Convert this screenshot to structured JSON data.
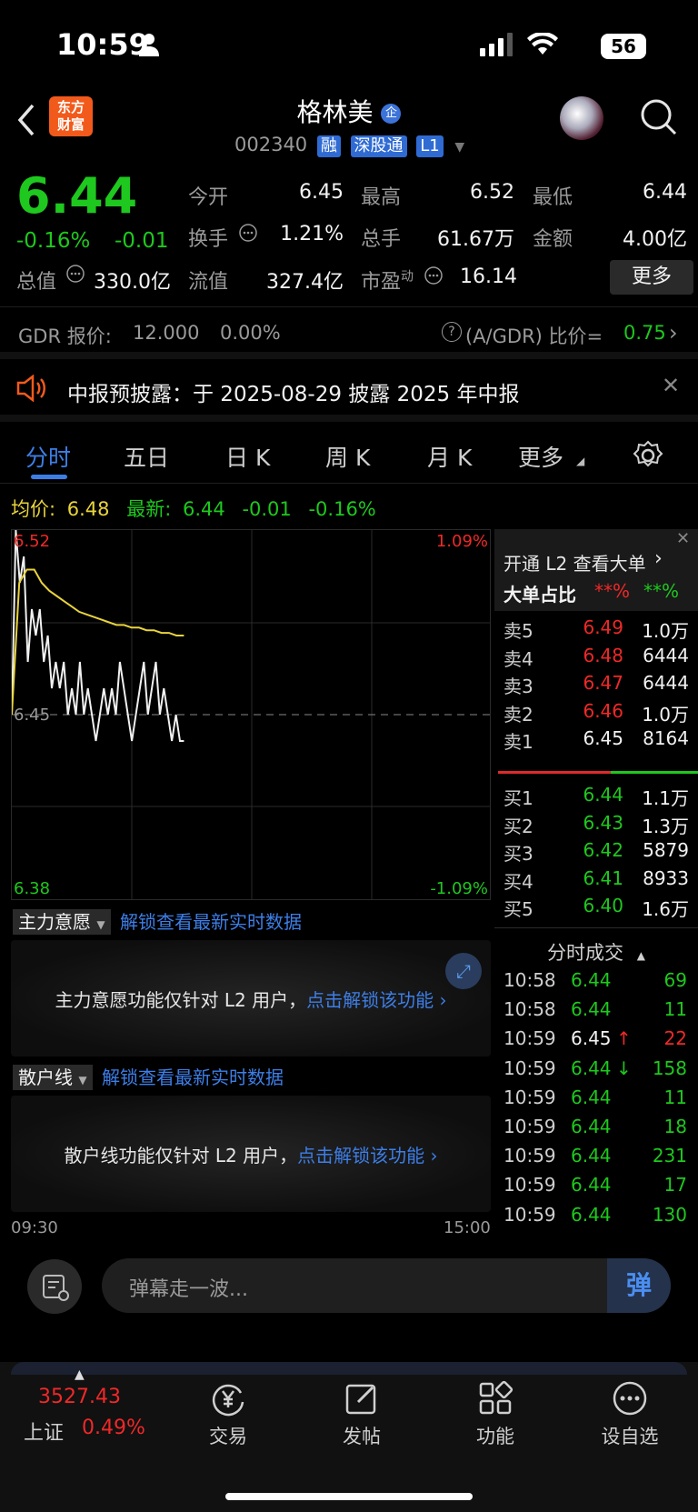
{
  "status": {
    "time": "10:59",
    "battery": "56"
  },
  "header": {
    "brand": "东方财富",
    "title": "格林美",
    "title_badge": "企",
    "code": "002340",
    "tags": [
      "融",
      "深股通",
      "L1"
    ]
  },
  "quote": {
    "price": "6.44",
    "pct": "-0.16%",
    "chg": "-0.01",
    "stats": [
      {
        "label": "今开",
        "value": "6.45"
      },
      {
        "label": "最高",
        "value": "6.52"
      },
      {
        "label": "最低",
        "value": "6.44"
      },
      {
        "label": "换手",
        "value": "1.21%"
      },
      {
        "label": "总手",
        "value": "61.67万"
      },
      {
        "label": "金额",
        "value": "4.00亿"
      },
      {
        "label": "总值",
        "value": "330.0亿"
      },
      {
        "label": "流值",
        "value": "327.4亿"
      },
      {
        "label": "市盈",
        "sup": "动",
        "value": "16.14"
      }
    ],
    "more": "更多"
  },
  "gdr": {
    "label": "GDR 报价:",
    "price": "12.000",
    "pct": "0.00%",
    "ratio_label": "(A/GDR) 比价=",
    "ratio": "0.75"
  },
  "notice": {
    "text": "中报预披露：于 2025-08-29 披露 2025 年中报"
  },
  "tabs": [
    "分时",
    "五日",
    "日 K",
    "周 K",
    "月 K",
    "更多"
  ],
  "infobar": {
    "avg_label": "均价:",
    "avg": "6.48",
    "last_label": "最新:",
    "last": "6.44",
    "chg": "-0.01",
    "pct": "-0.16%"
  },
  "chart": {
    "y_top": "6.52",
    "y_mid": "6.45",
    "y_bottom": "6.38",
    "pct_top": "1.09%",
    "pct_bottom": "-1.09%",
    "t_start": "09:30",
    "t_end": "15:00"
  },
  "chart_data": {
    "type": "line",
    "ylim": [
      6.38,
      6.52
    ],
    "series": [
      {
        "values": [
          6.45,
          6.52,
          6.5,
          6.51,
          6.47,
          6.49,
          6.48,
          6.49,
          6.47,
          6.48,
          6.46,
          6.47,
          6.46,
          6.47,
          6.45,
          6.46,
          6.45,
          6.47,
          6.45,
          6.46,
          6.45,
          6.44,
          6.45,
          6.46,
          6.45,
          6.46,
          6.45,
          6.47,
          6.46,
          6.45,
          6.44,
          6.45,
          6.46,
          6.47,
          6.45,
          6.46,
          6.47,
          6.45,
          6.46,
          6.45,
          6.44,
          6.45,
          6.44,
          6.44
        ]
      },
      {
        "values": [
          6.45,
          6.5,
          6.505,
          6.505,
          6.5,
          6.497,
          6.495,
          6.493,
          6.491,
          6.489,
          6.488,
          6.487,
          6.486,
          6.485,
          6.484,
          6.484,
          6.483,
          6.483,
          6.482,
          6.482,
          6.481,
          6.481,
          6.48,
          6.48
        ]
      }
    ]
  },
  "l2": {
    "link": "开通 L2 查看大单",
    "ratio_label": "大单占比",
    "red": "**%",
    "green": "**%"
  },
  "asks": [
    {
      "label": "卖5",
      "price": "6.49",
      "vol": "1.0万"
    },
    {
      "label": "卖4",
      "price": "6.48",
      "vol": "6444"
    },
    {
      "label": "卖3",
      "price": "6.47",
      "vol": "6444"
    },
    {
      "label": "卖2",
      "price": "6.46",
      "vol": "1.0万"
    },
    {
      "label": "卖1",
      "price": "6.45",
      "vol": "8164"
    }
  ],
  "bids": [
    {
      "label": "买1",
      "price": "6.44",
      "vol": "1.1万"
    },
    {
      "label": "买2",
      "price": "6.43",
      "vol": "1.3万"
    },
    {
      "label": "买3",
      "price": "6.42",
      "vol": "5879"
    },
    {
      "label": "买4",
      "price": "6.41",
      "vol": "8933"
    },
    {
      "label": "买5",
      "price": "6.40",
      "vol": "1.6万"
    }
  ],
  "trades_title": "分时成交",
  "trades": [
    {
      "t": "10:58",
      "p": "6.44",
      "a": "",
      "v": "69",
      "c": "green"
    },
    {
      "t": "10:58",
      "p": "6.44",
      "a": "",
      "v": "11",
      "c": "green"
    },
    {
      "t": "10:59",
      "p": "6.45",
      "a": "↑",
      "v": "22",
      "c": "red"
    },
    {
      "t": "10:59",
      "p": "6.44",
      "a": "↓",
      "v": "158",
      "c": "green"
    },
    {
      "t": "10:59",
      "p": "6.44",
      "a": "",
      "v": "11",
      "c": "green"
    },
    {
      "t": "10:59",
      "p": "6.44",
      "a": "",
      "v": "18",
      "c": "green"
    },
    {
      "t": "10:59",
      "p": "6.44",
      "a": "",
      "v": "231",
      "c": "green"
    },
    {
      "t": "10:59",
      "p": "6.44",
      "a": "",
      "v": "17",
      "c": "green"
    },
    {
      "t": "10:59",
      "p": "6.44",
      "a": "",
      "v": "130",
      "c": "green"
    }
  ],
  "sub1": {
    "title": "主力意愿",
    "unlock": "解锁查看最新实时数据",
    "msg": "主力意愿功能仅针对 L2 用户，",
    "link": "点击解锁该功能 ›"
  },
  "sub2": {
    "title": "散户线",
    "unlock": "解锁查看最新实时数据",
    "msg": "散户线功能仅针对 L2 用户，",
    "link": "点击解锁该功能 ›"
  },
  "danmu": {
    "placeholder": "弹幕走一波...",
    "send": "弹"
  },
  "bottom": {
    "index_value": "3527.43",
    "index_name": "上证",
    "index_pct": "0.49%",
    "nav": [
      "交易",
      "发帖",
      "功能",
      "设自选"
    ]
  }
}
